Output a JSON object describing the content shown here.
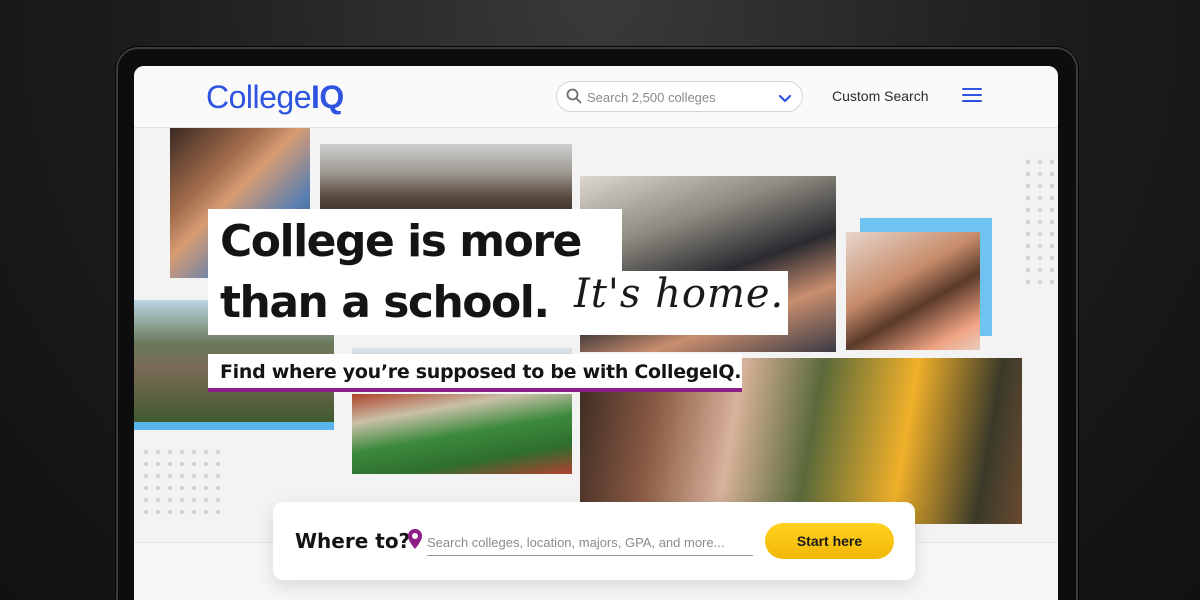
{
  "header": {
    "logo_text": "College",
    "logo_bold": "IQ",
    "search_placeholder": "Search 2,500 colleges",
    "custom_search_label": "Custom Search"
  },
  "hero": {
    "headline_line1": "College is more",
    "headline_line2": "than a school.",
    "script_text": "It's home.",
    "subheadline": "Find where you’re supposed to be with CollegeIQ."
  },
  "search_card": {
    "label": "Where to?",
    "placeholder": "Search colleges, location, majors, GPA, and more...",
    "button_label": "Start here"
  },
  "colors": {
    "brand_blue": "#2f55e0",
    "accent_purple": "#8d1e87",
    "cta_yellow": "#f2b705",
    "photo_accent": "#5ab4ec"
  },
  "icons": [
    "search-icon",
    "chevron-down-icon",
    "menu-icon",
    "location-pin-icon"
  ]
}
